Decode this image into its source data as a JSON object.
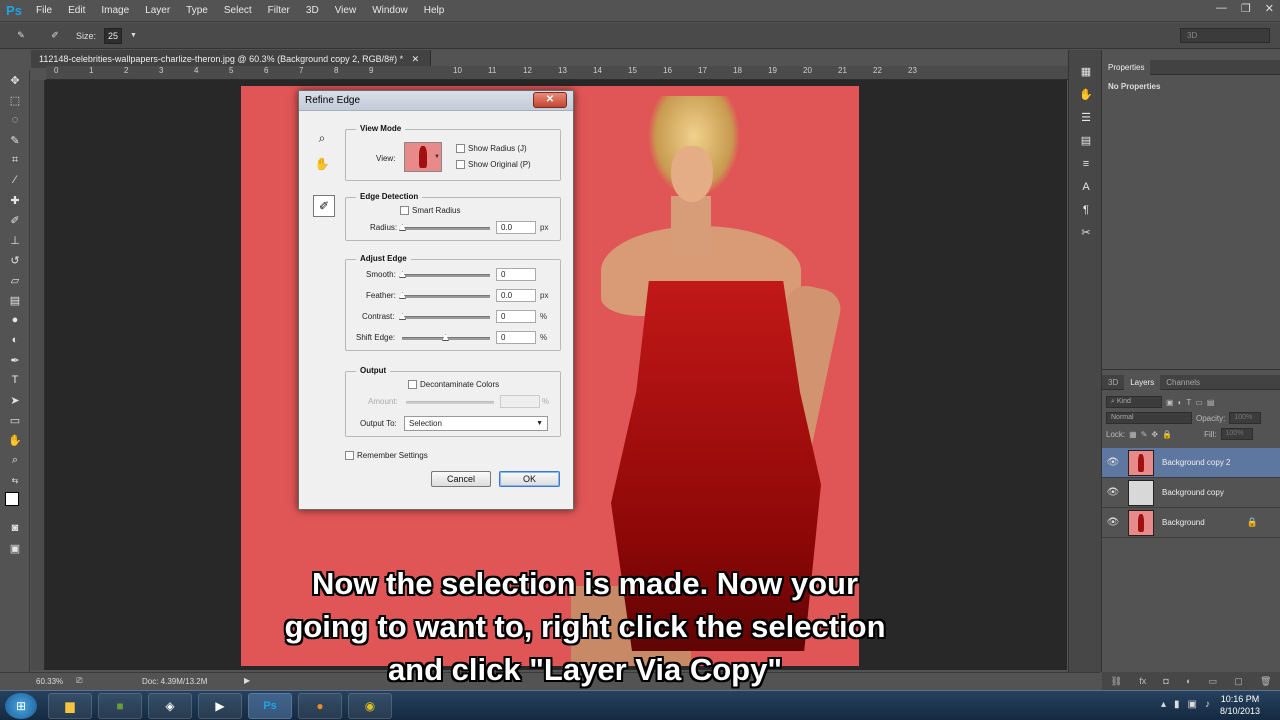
{
  "app": {
    "logo": "Ps",
    "accent": "#1da5e6"
  },
  "menu": [
    "File",
    "Edit",
    "Image",
    "Layer",
    "Type",
    "Select",
    "Filter",
    "3D",
    "View",
    "Window",
    "Help"
  ],
  "options_bar": {
    "size_label": "Size:",
    "size_value": "25",
    "workspace": "3D"
  },
  "document_tab": {
    "title": "112148-celebrities-wallpapers-charlize-theron.jpg @ 60.3% (Background copy 2, RGB/8#) *"
  },
  "ruler": [
    "0",
    "1",
    "2",
    "3",
    "4",
    "5",
    "6",
    "7",
    "8",
    "9",
    "10",
    "11",
    "12",
    "13",
    "14",
    "15",
    "16",
    "17",
    "18",
    "19",
    "20",
    "21",
    "22",
    "23"
  ],
  "refine_edge": {
    "title": "Refine Edge",
    "view_mode": {
      "title": "View Mode",
      "view_label": "View:",
      "show_radius": "Show Radius (J)",
      "show_original": "Show Original (P)"
    },
    "edge_detection": {
      "title": "Edge Detection",
      "smart_radius": "Smart Radius",
      "radius_label": "Radius:",
      "radius_value": "0.0",
      "radius_unit": "px"
    },
    "adjust_edge": {
      "title": "Adjust Edge",
      "smooth_label": "Smooth:",
      "smooth_value": "0",
      "feather_label": "Feather:",
      "feather_value": "0.0",
      "feather_unit": "px",
      "contrast_label": "Contrast:",
      "contrast_value": "0",
      "contrast_unit": "%",
      "shift_label": "Shift Edge:",
      "shift_value": "0",
      "shift_unit": "%"
    },
    "output": {
      "title": "Output",
      "decontaminate": "Decontaminate Colors",
      "amount_label": "Amount:",
      "amount_unit": "%",
      "output_to_label": "Output To:",
      "output_to_value": "Selection"
    },
    "remember": "Remember Settings",
    "cancel": "Cancel",
    "ok": "OK"
  },
  "properties": {
    "tab": "Properties",
    "empty": "No Properties"
  },
  "layers_panel": {
    "tabs": [
      "3D",
      "Layers",
      "Channels"
    ],
    "kind": "Kind",
    "blend": "Normal",
    "opacity_label": "Opacity:",
    "opacity_value": "100%",
    "lock_label": "Lock:",
    "fill_label": "Fill:",
    "fill_value": "100%",
    "layers": [
      "Background copy 2",
      "Background copy",
      "Background"
    ]
  },
  "status": {
    "zoom": "60.33%",
    "doc": "Doc: 4.39M/13.2M"
  },
  "caption": {
    "line1": "Now the selection is made. Now your",
    "line2": "going to want to, right click the selection",
    "line3": "and click \"Layer Via Copy\""
  },
  "taskbar": {
    "time": "10:16 PM",
    "date": "8/10/2013"
  },
  "icons": [
    "move-icon",
    "marquee-icon",
    "lasso-icon",
    "quick-selection-icon",
    "crop-icon",
    "eyedropper-icon",
    "healing-icon",
    "brush-icon",
    "stamp-icon",
    "history-brush-icon",
    "eraser-icon",
    "gradient-icon",
    "blur-icon",
    "dodge-icon",
    "pen-icon",
    "type-icon",
    "path-selection-icon",
    "shape-icon",
    "hand-icon",
    "zoom-icon"
  ]
}
